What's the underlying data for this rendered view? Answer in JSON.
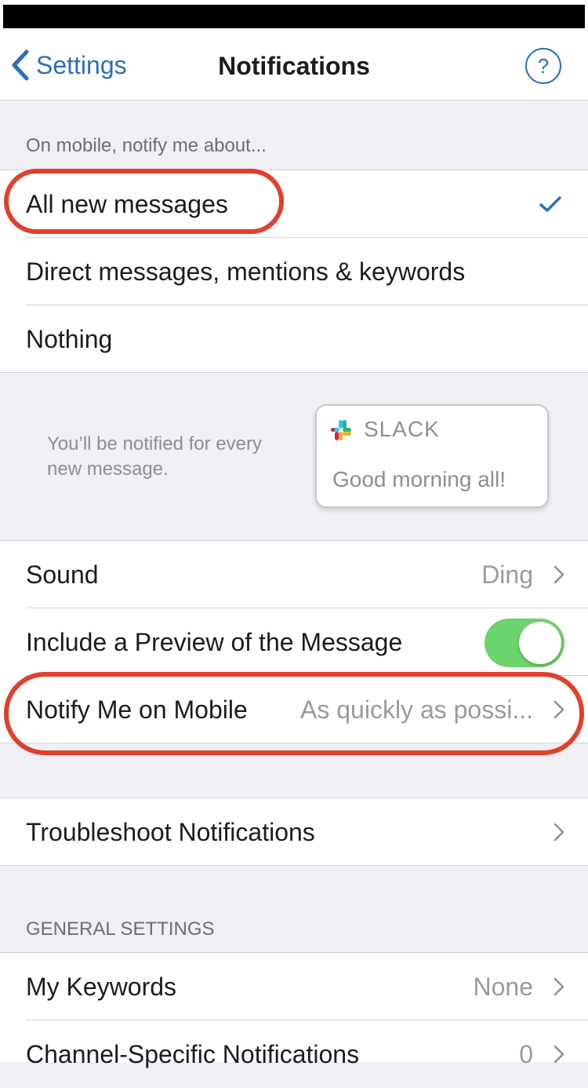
{
  "nav": {
    "back_label": "Settings",
    "title": "Notifications",
    "help_glyph": "?"
  },
  "mobile_notify": {
    "header": "On mobile, notify me about...",
    "options": [
      {
        "label": "All new messages",
        "selected": true
      },
      {
        "label": "Direct messages, mentions & keywords",
        "selected": false
      },
      {
        "label": "Nothing",
        "selected": false
      }
    ]
  },
  "preview": {
    "description": "You’ll be notified for every new message.",
    "card_app": "SLACK",
    "card_body": "Good morning all!"
  },
  "settings": {
    "sound": {
      "label": "Sound",
      "value": "Ding"
    },
    "include_preview": {
      "label": "Include a Preview of the Message",
      "enabled": true
    },
    "notify_on_mobile": {
      "label": "Notify Me on Mobile",
      "value": "As quickly as possi..."
    }
  },
  "troubleshoot": {
    "label": "Troubleshoot Notifications"
  },
  "general": {
    "header": "GENERAL SETTINGS",
    "my_keywords": {
      "label": "My Keywords",
      "value": "None"
    },
    "channel_specific": {
      "label": "Channel-Specific Notifications",
      "value": "0"
    }
  },
  "colors": {
    "accent": "#2a6fb8",
    "toggle_on": "#6cd46c",
    "highlight": "#e2402b",
    "grouped_background": "#efeff4"
  }
}
